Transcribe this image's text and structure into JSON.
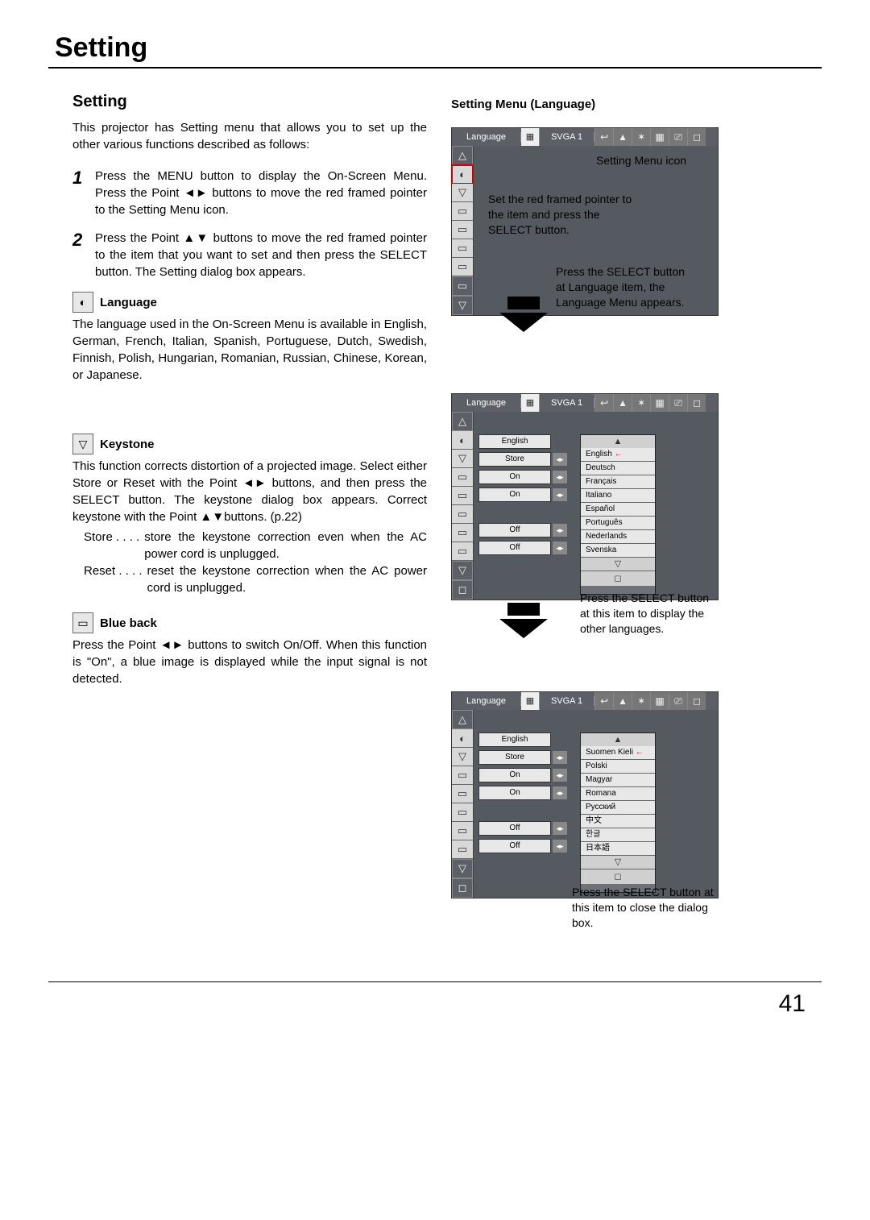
{
  "page": {
    "title": "Setting",
    "heading": "Setting",
    "number": "41"
  },
  "intro": "This projector has Setting menu that allows you to set up the other various functions described as follows:",
  "steps": [
    {
      "num": "1",
      "text": "Press the MENU button to display the On-Screen Menu.  Press the Point ◄► buttons to move the red framed pointer to the Setting Menu icon."
    },
    {
      "num": "2",
      "text": "Press the Point ▲▼ buttons to move the red framed  pointer to the item that you want to set and then press the SELECT button.  The Setting dialog box appears."
    }
  ],
  "sections": {
    "language": {
      "label": "Language",
      "text": "The language used in the On-Screen Menu is available in English, German, French, Italian, Spanish, Portuguese, Dutch, Swedish, Finnish, Polish, Hungarian, Romanian, Russian, Chinese, Korean, or Japanese."
    },
    "keystone": {
      "label": "Keystone",
      "text": "This function corrects distortion of a projected image. Select either Store or Reset with the Point ◄► buttons, and then press the SELECT button.  The keystone dialog box appears.  Correct keystone with the Point ▲▼buttons. (p.22)",
      "defs": [
        {
          "key": "Store . . . .",
          "val": "store the keystone correction even when the AC power cord is unplugged."
        },
        {
          "key": "Reset . . . .",
          "val": "reset the keystone correction when the AC power cord is unplugged."
        }
      ]
    },
    "blueback": {
      "label": "Blue back",
      "text": "Press the Point ◄► buttons to switch On/Off.  When this function is \"On\", a blue image is displayed while the input signal is not detected."
    }
  },
  "right": {
    "heading": "Setting Menu (Language)",
    "captions": {
      "c1": "Setting Menu icon",
      "c2": "Set the red framed pointer to the item and press the SELECT button.",
      "c3": "Press the SELECT button at Language item, the Language Menu appears.",
      "c4": "Press the SELECT button at this item to display the other languages.",
      "c5": "Press the SELECT button at this item to close the dialog box."
    },
    "osd": {
      "title": "Language",
      "mode": "SVGA 1",
      "sideIconsShort": [
        "△",
        "◐",
        "▽",
        "▭",
        "▭",
        "▭",
        "▭",
        "▭",
        "▽"
      ],
      "sideIconsLong": [
        "△",
        "◐",
        "▽",
        "▭",
        "▭",
        "▭",
        "▭",
        "▭",
        "▽",
        "◻"
      ],
      "topIcons": [
        "↩",
        "▲",
        "✶",
        "▦",
        "⎚",
        "◻"
      ],
      "rows1": [
        {
          "v": "English",
          "a": ""
        },
        {
          "v": "Store",
          "a": "◂▸"
        },
        {
          "v": "On",
          "a": "◂▸"
        },
        {
          "v": "On",
          "a": "◂▸"
        },
        {
          "v": "",
          "a": ""
        },
        {
          "v": "Off",
          "a": "◂▸"
        },
        {
          "v": "Off",
          "a": "◂▸"
        }
      ],
      "langs1": [
        "English",
        "Deutsch",
        "Français",
        "Italiano",
        "Español",
        "Português",
        "Nederlands",
        "Svenska"
      ],
      "langs2": [
        "Suomen Kieli",
        "Polski",
        "Magyar",
        "Romana",
        "Русский",
        "中文",
        "한글",
        "日本語"
      ]
    }
  }
}
